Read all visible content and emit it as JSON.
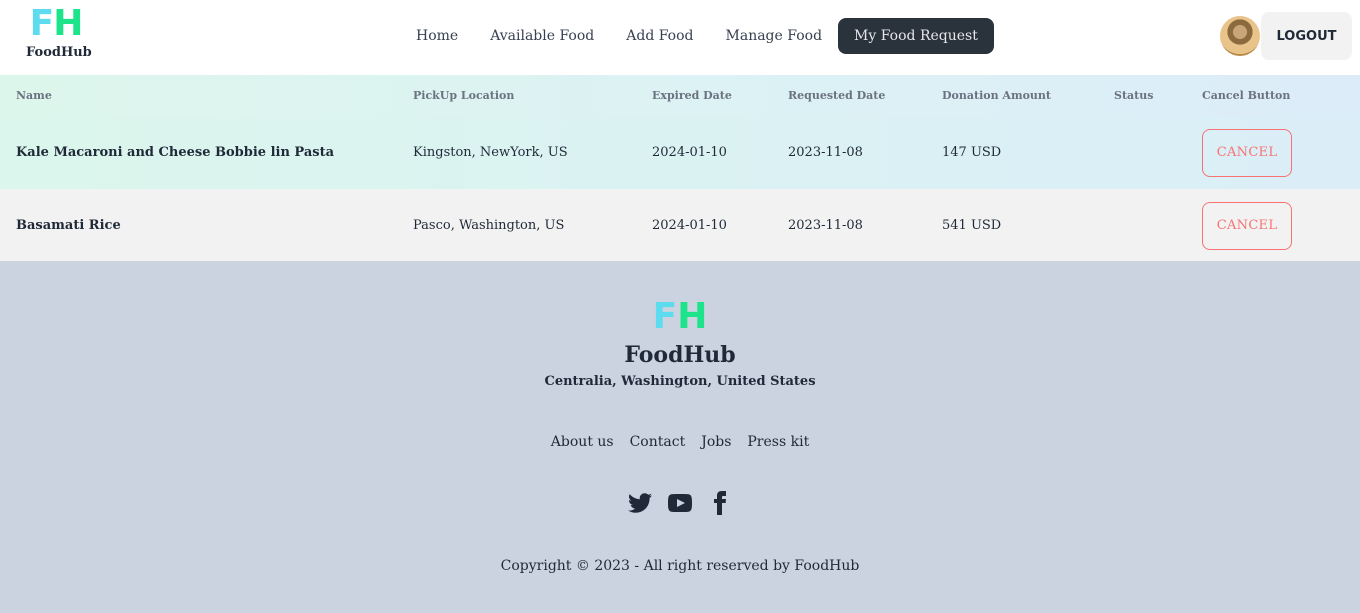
{
  "brand": {
    "logo_f": "F",
    "logo_h": "H",
    "name": "FoodHub"
  },
  "nav": {
    "items": [
      {
        "label": "Home"
      },
      {
        "label": "Available Food"
      },
      {
        "label": "Add Food"
      },
      {
        "label": "Manage Food"
      },
      {
        "label": "My Food Request",
        "active": true
      }
    ],
    "logout_label": "LOGOUT"
  },
  "table": {
    "headers": [
      "Name",
      "PickUp Location",
      "Expired Date",
      "Requested Date",
      "Donation Amount",
      "Status",
      "Cancel Button"
    ],
    "rows": [
      {
        "name": "Kale Macaroni and Cheese Bobbie lin Pasta",
        "location": "Kingston, NewYork, US",
        "expired": "2024-01-10",
        "requested": "2023-11-08",
        "amount": "147 USD",
        "status": "",
        "cancel_label": "CANCEL"
      },
      {
        "name": "Basamati Rice",
        "location": "Pasco, Washington, US",
        "expired": "2024-01-10",
        "requested": "2023-11-08",
        "amount": "541 USD",
        "status": "",
        "cancel_label": "CANCEL"
      }
    ]
  },
  "footer": {
    "logo_f": "F",
    "logo_h": "H",
    "name": "FoodHub",
    "address": "Centralia, Washington, United States",
    "links": [
      "About us",
      "Contact",
      "Jobs",
      "Press kit"
    ],
    "social": [
      "twitter-icon",
      "youtube-icon",
      "facebook-icon"
    ],
    "copyright": "Copyright © 2023 - All right reserved by FoodHub"
  },
  "colors": {
    "logo_f": "#5ddcf0",
    "logo_h": "#1de38a",
    "active_nav": "#2a323c",
    "cancel": "#f87272",
    "footer_bg": "#cad3df"
  }
}
